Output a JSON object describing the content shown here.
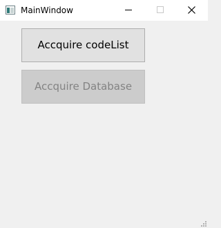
{
  "window": {
    "title": "MainWindow",
    "controls": {
      "minimize_icon": "minimize-icon",
      "maximize_icon": "maximize-icon",
      "close_icon": "close-icon",
      "maximize_enabled": false
    }
  },
  "main": {
    "buttons": [
      {
        "label": "Accquire codeList",
        "enabled": true
      },
      {
        "label": "Accquire Database",
        "enabled": false
      }
    ]
  },
  "colors": {
    "background": "#f0f0f0",
    "titlebar": "#ffffff",
    "button_face": "#e1e1e1",
    "button_disabled_face": "#cccccc",
    "button_disabled_text": "#838383"
  }
}
